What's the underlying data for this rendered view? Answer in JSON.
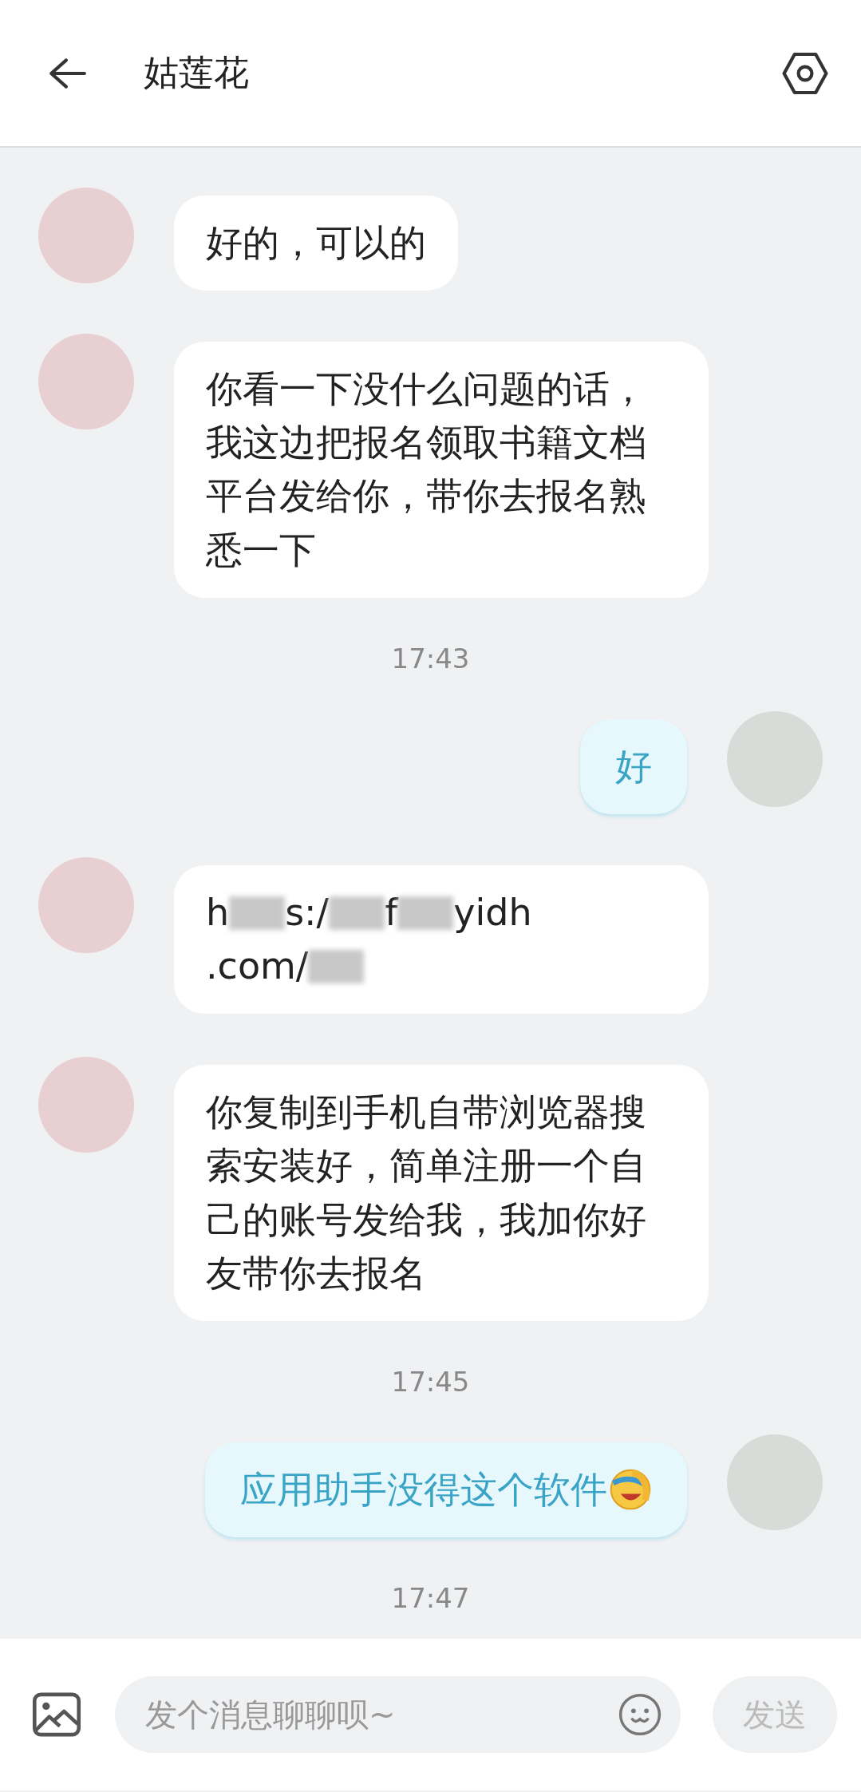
{
  "header": {
    "title": "姑莲花"
  },
  "messages": [
    {
      "kind": "received",
      "text": "好的，可以的"
    },
    {
      "kind": "received",
      "text": "你看一下没什么问题的话，我这边把报名领取书籍文档平台发给你，带你去报名熟悉一下"
    },
    {
      "kind": "time",
      "text": "17:43"
    },
    {
      "kind": "sent",
      "text": "好",
      "emoji": false
    },
    {
      "kind": "link",
      "lines": [
        [
          {
            "kind": "text",
            "text": "h"
          },
          {
            "kind": "blur"
          },
          {
            "kind": "text",
            "text": "s:/"
          },
          {
            "kind": "blur"
          },
          {
            "kind": "text",
            "text": "f"
          },
          {
            "kind": "blur"
          },
          {
            "kind": "text",
            "text": "yidh"
          }
        ],
        [
          {
            "kind": "text",
            "text": ".com/"
          },
          {
            "kind": "blur"
          }
        ]
      ]
    },
    {
      "kind": "received",
      "text": "你复制到手机自带浏览器搜索安装好，简单注册一个自己的账号发给我，我加你好友带你去报名"
    },
    {
      "kind": "time",
      "text": "17:45"
    },
    {
      "kind": "sent",
      "text": "应用助手没得这个软件",
      "emoji": true
    },
    {
      "kind": "time",
      "text": "17:47"
    }
  ],
  "composer": {
    "placeholder": "发个消息聊聊呗~",
    "send": "发送",
    "send_disabled": true
  }
}
